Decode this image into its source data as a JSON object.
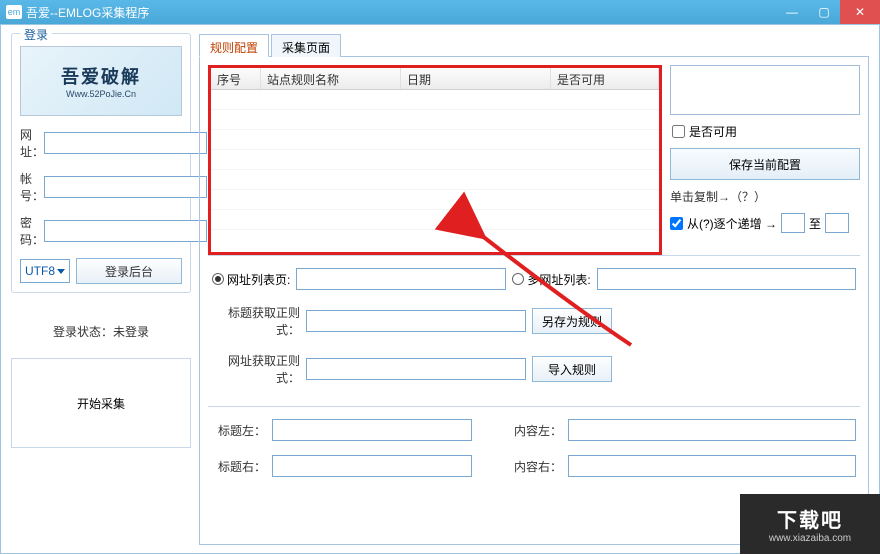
{
  "window": {
    "icon": "em",
    "title": "吾爱--EMLOG采集程序"
  },
  "sidebar": {
    "group_title": "登录",
    "logo_line1": "吾爱破解",
    "logo_line2": "Www.52PoJie.Cn",
    "url_label": "网址：",
    "user_label": "帐号：",
    "pass_label": "密码：",
    "encoding": "UTF8",
    "login_btn": "登录后台",
    "status_prefix": "登录状态：",
    "status_value": "未登录",
    "start_btn": "开始采集"
  },
  "tabs": {
    "t1": "规则配置",
    "t2": "采集页面"
  },
  "table": {
    "h1": "序号",
    "h2": "站点规则名称",
    "h3": "日期",
    "h4": "是否可用"
  },
  "right": {
    "enable_chk": "是否可用",
    "save_btn": "保存当前配置",
    "copy_hint": "单击复制→（？）",
    "incr_chk": "从(?)逐个递增 →",
    "incr_to": "至"
  },
  "url_section": {
    "list_radio": "网址列表页:",
    "multi_radio": "多网址列表:",
    "title_regex": "标题获取正则式：",
    "url_regex": "网址获取正则式：",
    "save_rule_btn": "另存为规则",
    "import_btn": "导入规则"
  },
  "content_section": {
    "title_left": "标题左：",
    "title_right": "标题右：",
    "content_left": "内容左：",
    "content_right": "内容右："
  },
  "watermark": {
    "line1": "下载吧",
    "line2": "www.xiazaiba.com"
  }
}
